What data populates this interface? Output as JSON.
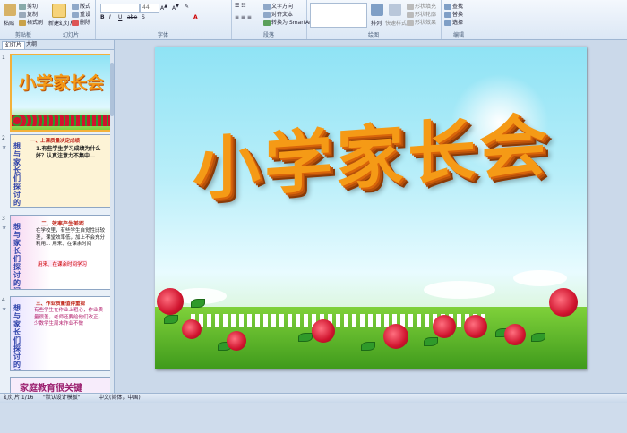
{
  "ribbon": {
    "clipboard": {
      "paste": "粘贴",
      "cut": "剪切",
      "copy": "复制",
      "format_painter": "格式刷",
      "label": "剪贴板"
    },
    "slides": {
      "new_slide": "新建幻灯片",
      "layout": "版式",
      "reset": "重设",
      "delete": "删除",
      "label": "幻灯片"
    },
    "font": {
      "size": "44",
      "label": "字体"
    },
    "paragraph": {
      "text_direction": "文字方向",
      "align_text": "对齐文本",
      "smartart": "转换为 SmartArt",
      "label": "段落"
    },
    "drawing": {
      "arrange": "排列",
      "quick_styles": "快速样式",
      "shape_fill": "形状填充",
      "shape_outline": "形状轮廓",
      "shape_effects": "形状效果",
      "label": "绘图"
    },
    "editing": {
      "find": "查找",
      "replace": "替换",
      "select": "选择",
      "label": "编辑"
    }
  },
  "panel": {
    "tab_slides": "幻灯片",
    "tab_outline": "大纲",
    "thumbs": [
      {
        "num": "1",
        "title": "小学家长会"
      },
      {
        "num": "2",
        "heading": "一、上课质量决定成绩",
        "side": "想与家长们探讨的问题",
        "body": "1.有些学生学习成绩为什么好？认真注意力不集中…"
      },
      {
        "num": "3",
        "heading": "二、效率产生差距",
        "side": "想与家长们探讨的问题",
        "body": "在学校里，有些学生自觉性比较差，课堂效率低，加上不会充分利用… 用来、在课余时间",
        "highlight": "用来、在课余时间学习"
      },
      {
        "num": "4",
        "heading": "三、作业质量值得重视",
        "side": "想与家长们探讨的问题",
        "body": "有些学生在作业上粗心，作业质量很差，老师还要给他们改正。少数学生周末作业不做",
        "footer": "家庭教育很关键"
      }
    ]
  },
  "slide": {
    "title": "小学家长会"
  },
  "status": {
    "slide_info": "幻灯片 1/16",
    "theme": "\"默认设计模板\"",
    "language": "中文(简体，中国)"
  }
}
